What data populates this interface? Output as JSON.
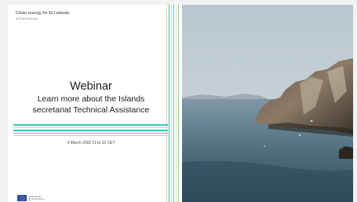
{
  "header": {
    "title": "Clean energy for EU islands",
    "tag": "#CE4EUislands"
  },
  "main": {
    "heading": "Webinar",
    "subtitle_line1": "Learn more about the Islands",
    "subtitle_line2": "secretariat Technical Assistance",
    "date": "3 March 2022 11 to 12 CET"
  },
  "footer": {
    "logo_line1": "European",
    "logo_line2": "Commission"
  },
  "colors": {
    "accent_teal": "#3fbfb4",
    "accent_yellow": "#e8e07a",
    "accent_blue": "#2e8fd1",
    "eu_blue": "#2b4aa8"
  },
  "photo": {
    "subject": "coastal-cliff-sea-landscape"
  }
}
